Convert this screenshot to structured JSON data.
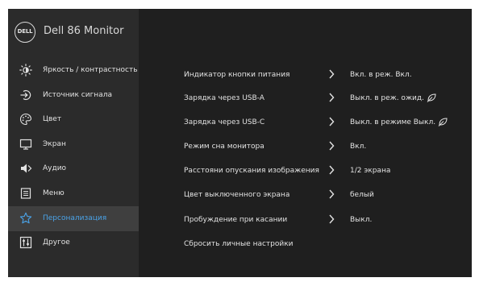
{
  "osd": {
    "logo_text": "DELL",
    "model": "Dell 86 Monitor",
    "colors": {
      "background": "#1f1f1f",
      "sidebar": "#2b2b2b",
      "active": "#3f3f3f",
      "accent": "#4aa3e8",
      "text": "#e2e2e2"
    },
    "menu": [
      {
        "label": "Яркость / контрастность",
        "icon": "brightness-icon"
      },
      {
        "label": "Источник сигнала",
        "icon": "input-source-icon"
      },
      {
        "label": "Цвет",
        "icon": "color-palette-icon"
      },
      {
        "label": "Экран",
        "icon": "display-icon"
      },
      {
        "label": "Аудио",
        "icon": "speaker-icon"
      },
      {
        "label": "Меню",
        "icon": "menu-icon"
      },
      {
        "label": "Персонализация",
        "icon": "star-icon",
        "selected": true
      },
      {
        "label": "Другое",
        "icon": "other-settings-icon"
      }
    ],
    "settings": [
      {
        "name": "Индикатор кнопки питания",
        "value": "Вкл. в реж. Вкл."
      },
      {
        "name": "Зарядка через USB-A",
        "value": "Выкл. в реж. ожид.",
        "eco_icon": "leaf-icon"
      },
      {
        "name": "Зарядка через USB-C",
        "value": "Выкл. в режиме Выкл.",
        "eco_icon": "leaf-icon"
      },
      {
        "name": "Режим сна монитора",
        "value": "Вкл."
      },
      {
        "name": "Расстояни опускания изображения",
        "value": "1/2 экрана"
      },
      {
        "name": "Цвет выключенного экрана",
        "value": "белый"
      },
      {
        "name": "Пробуждение при касании",
        "value": "Выкл."
      },
      {
        "name": "Сбросить личные настройки",
        "value": ""
      }
    ]
  }
}
